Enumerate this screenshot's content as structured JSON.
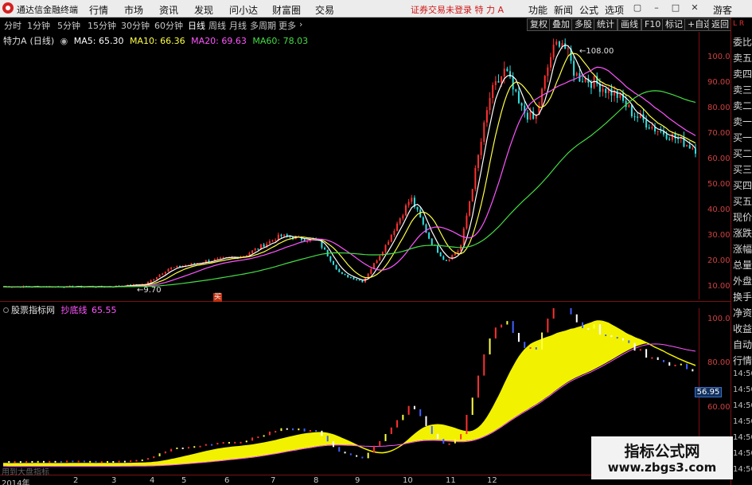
{
  "app": {
    "title": "通达信金融终端",
    "menu": [
      "行情",
      "市场",
      "资讯",
      "发现",
      "问小达",
      "财富圈",
      "交易"
    ],
    "notice": "证券交易未登录  特 力 A",
    "right_menu": [
      "功能",
      "新闻",
      "公式",
      "选项",
      "游客"
    ]
  },
  "toolbar": {
    "periods": [
      "分时",
      "1分钟",
      "5分钟",
      "15分钟",
      "30分钟",
      "60分钟",
      "日线",
      "周线",
      "月线",
      "多周期",
      "更多"
    ],
    "active_period": "日线",
    "buttons": [
      "复权",
      "叠加",
      "多股",
      "统计",
      "画线",
      "F10",
      "标记",
      "+自选",
      "返回"
    ]
  },
  "price_header": {
    "stock": "特力A",
    "period": "(日线)",
    "ma": [
      {
        "label": "MA5: 65.30",
        "color": "#ffffff"
      },
      {
        "label": "MA10: 66.36",
        "color": "#ffff44"
      },
      {
        "label": "MA20: 69.63",
        "color": "#ff55ff"
      },
      {
        "label": "MA60: 78.03",
        "color": "#44dd44"
      }
    ]
  },
  "indicator_header": {
    "name": "股票指标网",
    "line": "抄底线",
    "value": "65.55"
  },
  "price_axis": [
    "100.0",
    "90.00",
    "80.00",
    "70.00",
    "60.00",
    "50.00",
    "40.00",
    "30.00",
    "20.00",
    "10.00"
  ],
  "indicator_axis": [
    "100.0",
    "80.00",
    "60.00",
    "40.00"
  ],
  "annotations": {
    "high": "108.00",
    "low": "9.70",
    "current_badge": "56.95",
    "signal": "买"
  },
  "sidebar": {
    "corner": "L R",
    "items": [
      "委比",
      "卖五",
      "卖四",
      "卖三",
      "卖二",
      "卖一",
      "买一",
      "买二",
      "买三",
      "买四",
      "买五",
      "现价",
      "涨跌",
      "涨幅",
      "总量",
      "外盘",
      "换手",
      "净资",
      "收益",
      "自动",
      "行情",
      "14:50",
      "14:50",
      "14:50",
      "14:50",
      "14:50",
      "14:50",
      "14:50"
    ]
  },
  "date_axis": [
    "2014年",
    "2",
    "3",
    "4",
    "5",
    "6",
    "7",
    "8",
    "9",
    "10",
    "11",
    "12"
  ],
  "left_note": "用到大盘指标",
  "watermark": {
    "title": "指标公式网",
    "url": "www.zbgs3.com"
  },
  "colors": {
    "up": "#ff3030",
    "down": "#30e0e0",
    "ma5": "#ffffff",
    "ma10": "#ffff44",
    "ma20": "#ff55ff",
    "ma60": "#44dd44",
    "band": "#ffff00",
    "axis": "#d04040"
  },
  "chart_data": {
    "type": "line",
    "x": [
      "2014-01",
      "2014-02",
      "2014-03",
      "2014-04",
      "2014-05",
      "2014-06",
      "2014-07",
      "2014-08",
      "2014-09",
      "2014-10",
      "2014-11",
      "2014-12"
    ],
    "series": [
      {
        "name": "MA5",
        "values": [
          10,
          10,
          12,
          19,
          20,
          27,
          12,
          45,
          22,
          90,
          88,
          65
        ]
      },
      {
        "name": "MA60",
        "values": [
          10,
          10,
          11,
          16,
          17,
          22,
          24,
          30,
          35,
          55,
          80,
          78
        ]
      }
    ],
    "ylim": [
      5,
      110
    ],
    "indicator": {
      "name": "抄底线",
      "values": [
        5,
        5,
        8,
        10,
        12,
        22,
        10,
        30,
        25,
        50,
        78,
        65
      ],
      "ylim": [
        30,
        105
      ]
    }
  }
}
